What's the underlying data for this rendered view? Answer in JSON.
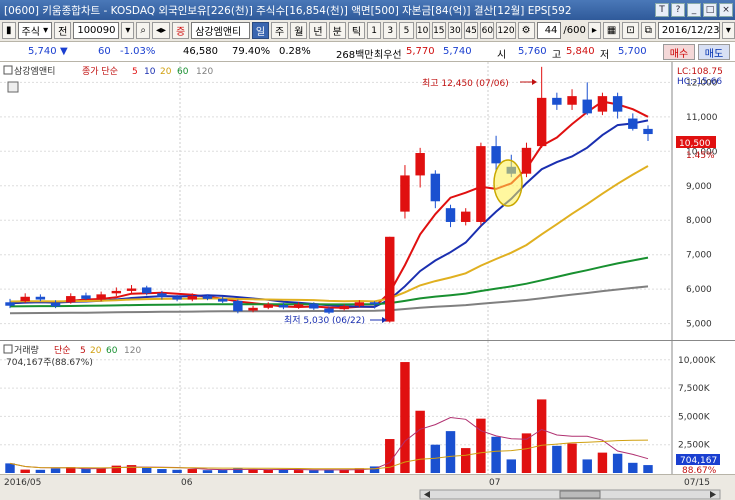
{
  "titlebar": {
    "title": "[0600] 키움종합차트 - KOSDAQ 외국인보유[226(천)] 주식수[16,854(천)] 액면[500] 자본금[84(억)] 결산[12월] EPS[592",
    "icons": [
      "T",
      "?",
      "_",
      "□",
      "×"
    ]
  },
  "toolbar": {
    "type_select": "주식",
    "prev_label": "전",
    "code": "100090",
    "stock_badge": "증",
    "stock_name": "삼강엠앤티",
    "periods": [
      "일",
      "주",
      "월",
      "년",
      "분",
      "틱"
    ],
    "selected_period": "일",
    "minute_options": [
      "1",
      "3",
      "5",
      "10",
      "15",
      "30",
      "45",
      "60",
      "120"
    ],
    "count": "44",
    "count_total": "/600",
    "date": "2016/12/23"
  },
  "quote": {
    "price": "5,740",
    "direction": "▼",
    "change": "60",
    "change_pct": "-1.03%",
    "volume": "46,580",
    "volume_ratio": "79.40%",
    "turnover": "0.28%",
    "amount": "268백만",
    "bid_label": "최우선",
    "bid1": "5,770",
    "bid2": "5,740",
    "open_label": "시",
    "open": "5,760",
    "high_label": "고",
    "high": "5,840",
    "low_label": "저",
    "low": "5,700",
    "buy_label": "매수",
    "sell_label": "매도"
  },
  "price_pane": {
    "stock_label": "삼강엠앤티",
    "ma_label": "종가 단순",
    "ma_periods": [
      "5",
      "10",
      "20",
      "60",
      "120"
    ],
    "ma_colors": [
      "#e01010",
      "#1a2fb0",
      "#e0b020",
      "#189030",
      "#808080"
    ],
    "lc": "LC:108.75",
    "hc": "HC:-15.66",
    "high_annot": "최고 12,450 (07/06)",
    "low_annot": "최저 5,030 (06/22)",
    "current_price": "10,500",
    "current_pct": "1.45%",
    "y_ticks": [
      "12,000",
      "11,000",
      "10,000",
      "9,000",
      "8,000",
      "7,000",
      "6,000",
      "5,000"
    ]
  },
  "volume_pane": {
    "label": "거래량",
    "ma_label": "단순",
    "ma_periods": [
      "5",
      "20",
      "60",
      "120"
    ],
    "info": "704,167주(88.67%)",
    "current_value": "704,167",
    "current_pct": "88.67%",
    "y_ticks": [
      "10,000K",
      "7,500K",
      "5,000K",
      "2,500K"
    ]
  },
  "x_axis": {
    "labels": [
      "2016/05",
      "06",
      "07",
      "07/15"
    ]
  },
  "chart_data": {
    "type": "candlestick",
    "y_range": [
      4700,
      12300
    ],
    "x_labels": [
      "2016/05",
      "06",
      "07",
      "07/15"
    ],
    "candles": [
      {
        "o": 5620,
        "c": 5520,
        "h": 5720,
        "l": 5450
      },
      {
        "o": 5650,
        "c": 5780,
        "h": 5880,
        "l": 5600
      },
      {
        "o": 5780,
        "c": 5700,
        "h": 5850,
        "l": 5650
      },
      {
        "o": 5600,
        "c": 5500,
        "h": 5680,
        "l": 5450
      },
      {
        "o": 5620,
        "c": 5800,
        "h": 5880,
        "l": 5580
      },
      {
        "o": 5820,
        "c": 5720,
        "h": 5900,
        "l": 5680
      },
      {
        "o": 5700,
        "c": 5850,
        "h": 5930,
        "l": 5650
      },
      {
        "o": 5880,
        "c": 5950,
        "h": 6050,
        "l": 5800
      },
      {
        "o": 5950,
        "c": 6020,
        "h": 6120,
        "l": 5880
      },
      {
        "o": 6050,
        "c": 5880,
        "h": 6100,
        "l": 5820
      },
      {
        "o": 5880,
        "c": 5780,
        "h": 5950,
        "l": 5700
      },
      {
        "o": 5780,
        "c": 5700,
        "h": 5830,
        "l": 5650
      },
      {
        "o": 5700,
        "c": 5800,
        "h": 5880,
        "l": 5650
      },
      {
        "o": 5800,
        "c": 5720,
        "h": 5850,
        "l": 5680
      },
      {
        "o": 5720,
        "c": 5640,
        "h": 5780,
        "l": 5600
      },
      {
        "o": 5660,
        "c": 5360,
        "h": 5700,
        "l": 5300
      },
      {
        "o": 5380,
        "c": 5460,
        "h": 5520,
        "l": 5330
      },
      {
        "o": 5460,
        "c": 5560,
        "h": 5620,
        "l": 5420
      },
      {
        "o": 5540,
        "c": 5470,
        "h": 5600,
        "l": 5420
      },
      {
        "o": 5470,
        "c": 5560,
        "h": 5620,
        "l": 5430
      },
      {
        "o": 5580,
        "c": 5440,
        "h": 5620,
        "l": 5400
      },
      {
        "o": 5440,
        "c": 5320,
        "h": 5480,
        "l": 5280
      },
      {
        "o": 5420,
        "c": 5510,
        "h": 5560,
        "l": 5380
      },
      {
        "o": 5520,
        "c": 5620,
        "h": 5680,
        "l": 5480
      },
      {
        "o": 5620,
        "c": 5560,
        "h": 5650,
        "l": 5440
      },
      {
        "o": 5060,
        "c": 7520,
        "h": 7520,
        "l": 5030
      },
      {
        "o": 8250,
        "c": 9300,
        "h": 9600,
        "l": 8050
      },
      {
        "o": 9300,
        "c": 9950,
        "h": 10100,
        "l": 8950
      },
      {
        "o": 9350,
        "c": 8550,
        "h": 9450,
        "l": 8350
      },
      {
        "o": 8350,
        "c": 7950,
        "h": 8450,
        "l": 7800
      },
      {
        "o": 7950,
        "c": 8250,
        "h": 8350,
        "l": 7850
      },
      {
        "o": 7950,
        "c": 10150,
        "h": 10250,
        "l": 7850
      },
      {
        "o": 10150,
        "c": 9650,
        "h": 10450,
        "l": 9450
      },
      {
        "o": 9550,
        "c": 9350,
        "h": 9900,
        "l": 9250
      },
      {
        "o": 9350,
        "c": 10100,
        "h": 10250,
        "l": 9250
      },
      {
        "o": 10150,
        "c": 11550,
        "h": 12450,
        "l": 10100
      },
      {
        "o": 11550,
        "c": 11350,
        "h": 11700,
        "l": 11200
      },
      {
        "o": 11350,
        "c": 11600,
        "h": 11800,
        "l": 11200
      },
      {
        "o": 11500,
        "c": 11100,
        "h": 12000,
        "l": 11050
      },
      {
        "o": 11150,
        "c": 11600,
        "h": 11700,
        "l": 11050
      },
      {
        "o": 11600,
        "c": 11150,
        "h": 11700,
        "l": 10950
      },
      {
        "o": 10950,
        "c": 10650,
        "h": 11100,
        "l": 10600
      },
      {
        "o": 10650,
        "c": 10500,
        "h": 10750,
        "l": 10300
      }
    ],
    "volume": [
      850,
      300,
      280,
      400,
      520,
      380,
      420,
      650,
      700,
      450,
      350,
      280,
      350,
      250,
      260,
      420,
      300,
      280,
      300,
      260,
      250,
      280,
      300,
      420,
      580,
      3000,
      9800,
      5500,
      2500,
      3700,
      2200,
      4800,
      3200,
      1200,
      3500,
      6500,
      2400,
      2600,
      1200,
      1800,
      1700,
      900,
      700
    ]
  }
}
